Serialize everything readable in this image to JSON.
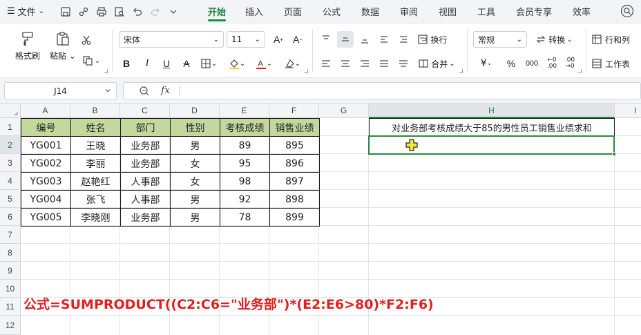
{
  "menubar": {
    "file_label": "文件",
    "tabs": [
      {
        "label": "开始",
        "active": true
      },
      {
        "label": "插入",
        "active": false
      },
      {
        "label": "页面",
        "active": false
      },
      {
        "label": "公式",
        "active": false
      },
      {
        "label": "数据",
        "active": false
      },
      {
        "label": "审阅",
        "active": false
      },
      {
        "label": "视图",
        "active": false
      },
      {
        "label": "工具",
        "active": false
      },
      {
        "label": "会员专享",
        "active": false
      },
      {
        "label": "效率",
        "active": false
      }
    ]
  },
  "ribbon": {
    "format_painter": "格式刷",
    "paste": "粘贴",
    "font_name": "宋体",
    "font_size": "11",
    "wrap": "换行",
    "merge": "合并",
    "number_format": "常规",
    "convert": "转换",
    "rows_cols": "行和列",
    "worksheet": "工作表",
    "accent_color": "#1e7f3c"
  },
  "formula_bar": {
    "cell_ref": "J14",
    "fx_label": "fx",
    "content": ""
  },
  "sheet": {
    "columns": [
      "A",
      "B",
      "C",
      "D",
      "E",
      "F",
      "G",
      "H",
      "I"
    ],
    "rows": [
      "1",
      "2",
      "3",
      "4",
      "5",
      "6",
      "7",
      "8",
      "9",
      "10",
      "11",
      "12"
    ],
    "table": {
      "headers": [
        "编号",
        "姓名",
        "部门",
        "性别",
        "考核成绩",
        "销售业绩"
      ],
      "rows": [
        [
          "YG001",
          "王晓",
          "业务部",
          "男",
          "89",
          "895"
        ],
        [
          "YG002",
          "李丽",
          "业务部",
          "女",
          "95",
          "896"
        ],
        [
          "YG003",
          "赵艳红",
          "人事部",
          "女",
          "98",
          "897"
        ],
        [
          "YG004",
          "张飞",
          "人事部",
          "男",
          "92",
          "898"
        ],
        [
          "YG005",
          "李晓刚",
          "业务部",
          "男",
          "78",
          "899"
        ]
      ],
      "header_color": "#c4d89e"
    },
    "h1_text": "对业务部考核成绩大于85的男性员工销售业绩求和",
    "h2_value": "",
    "formula_note": "公式=SUMPRODUCT((C2:C6=\"业务部\")*(E2:E6>80)*F2:F6)",
    "note_color": "#e02020"
  }
}
